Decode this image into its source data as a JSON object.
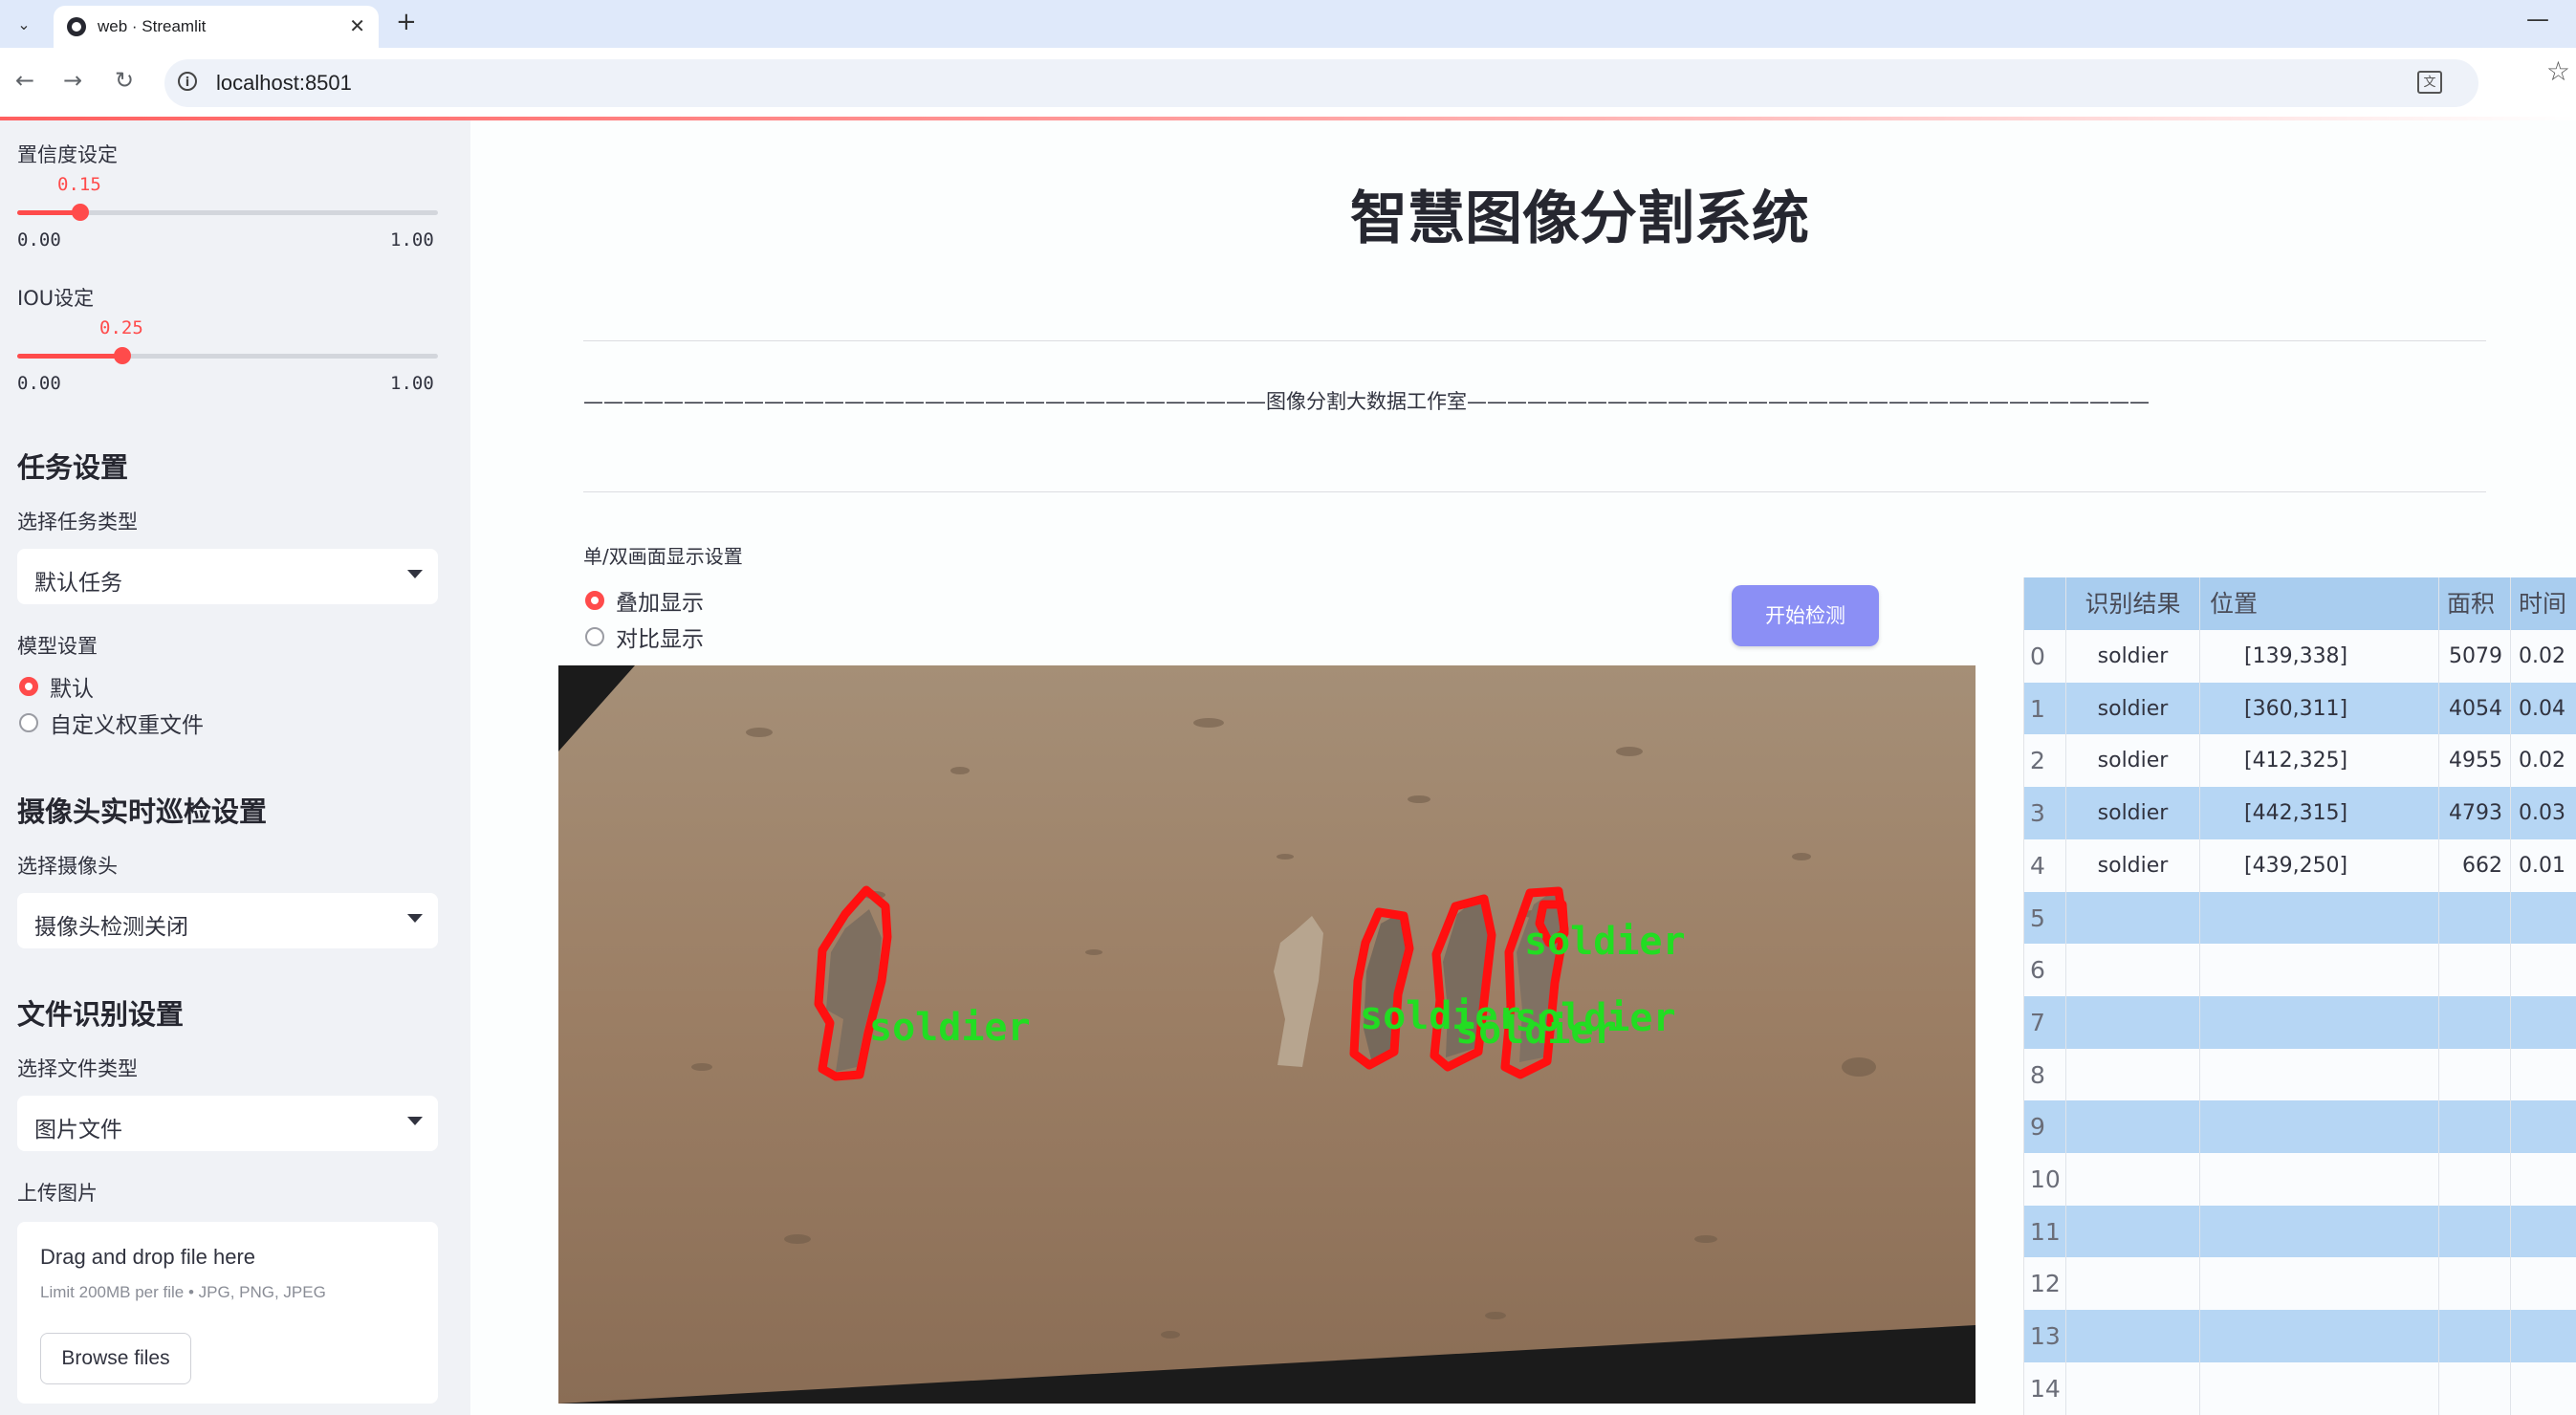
{
  "browser": {
    "tab_title": "web · Streamlit",
    "url": "localhost:8501"
  },
  "sidebar": {
    "confidence": {
      "label": "置信度设定",
      "value": "0.15",
      "fraction": 0.15,
      "min": "0.00",
      "max": "1.00"
    },
    "iou": {
      "label": "IOU设定",
      "value": "0.25",
      "fraction": 0.25,
      "min": "0.00",
      "max": "1.00"
    },
    "task_header": "任务设置",
    "task_type_label": "选择任务类型",
    "task_type_value": "默认任务",
    "model_label": "模型设置",
    "model_options": [
      "默认",
      "自定义权重文件"
    ],
    "model_selected": "默认",
    "camera_header": "摄像头实时巡检设置",
    "camera_label": "选择摄像头",
    "camera_value": "摄像头检测关闭",
    "file_header": "文件识别设置",
    "file_type_label": "选择文件类型",
    "file_type_value": "图片文件",
    "upload_label": "上传图片",
    "upload_title": "Drag and drop file here",
    "upload_limit": "Limit 200MB per file • JPG, PNG, JPEG",
    "browse_label": "Browse files"
  },
  "main": {
    "title": "智慧图像分割系统",
    "studio_line": "——————————————————————————————————图像分割大数据工作室——————————————————————————————————",
    "display_mode_label": "单/双画面显示设置",
    "display_options": [
      "叠加显示",
      "对比显示"
    ],
    "display_selected": "叠加显示",
    "detect_button": "开始检测",
    "detection_labels": [
      "soldier",
      "soldier",
      "soldier",
      "soldier",
      "soldier"
    ]
  },
  "table": {
    "columns": [
      "识别结果",
      "位置",
      "面积",
      "时间"
    ],
    "rows": [
      {
        "index": "0",
        "name": "soldier",
        "position": "[139,338]",
        "area": "5079",
        "time": "0.02"
      },
      {
        "index": "1",
        "name": "soldier",
        "position": "[360,311]",
        "area": "4054",
        "time": "0.04"
      },
      {
        "index": "2",
        "name": "soldier",
        "position": "[412,325]",
        "area": "4955",
        "time": "0.02"
      },
      {
        "index": "3",
        "name": "soldier",
        "position": "[442,315]",
        "area": "4793",
        "time": "0.03"
      },
      {
        "index": "4",
        "name": "soldier",
        "position": "[439,250]",
        "area": "662",
        "time": "0.01"
      },
      {
        "index": "5",
        "name": "",
        "position": "",
        "area": "",
        "time": ""
      },
      {
        "index": "6",
        "name": "",
        "position": "",
        "area": "",
        "time": ""
      },
      {
        "index": "7",
        "name": "",
        "position": "",
        "area": "",
        "time": ""
      },
      {
        "index": "8",
        "name": "",
        "position": "",
        "area": "",
        "time": ""
      },
      {
        "index": "9",
        "name": "",
        "position": "",
        "area": "",
        "time": ""
      },
      {
        "index": "10",
        "name": "",
        "position": "",
        "area": "",
        "time": ""
      },
      {
        "index": "11",
        "name": "",
        "position": "",
        "area": "",
        "time": ""
      },
      {
        "index": "12",
        "name": "",
        "position": "",
        "area": "",
        "time": ""
      },
      {
        "index": "13",
        "name": "",
        "position": "",
        "area": "",
        "time": ""
      },
      {
        "index": "14",
        "name": "",
        "position": "",
        "area": "",
        "time": ""
      }
    ]
  },
  "colors": {
    "accent": "#ff4b4b",
    "button": "#8b8ff5",
    "mask": "#ff0000",
    "label": "#22dd22",
    "table_stripe": "#b6d6f4"
  }
}
